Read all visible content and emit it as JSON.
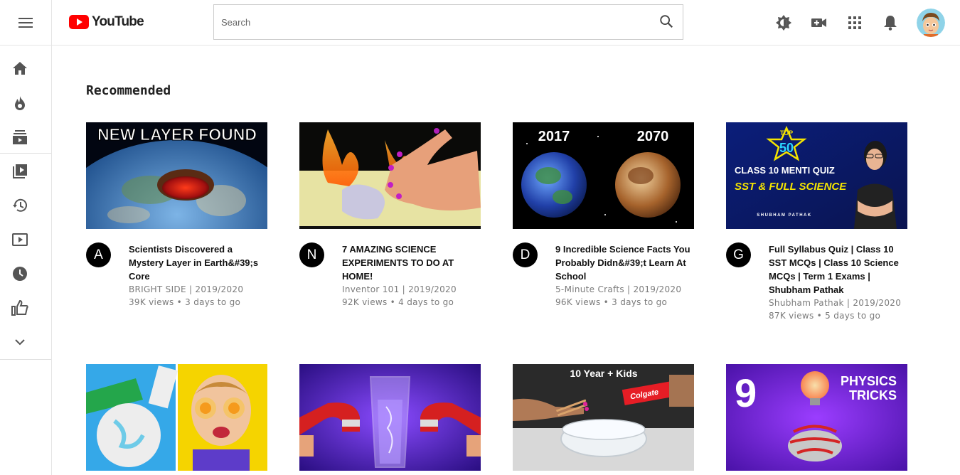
{
  "app": {
    "logo_text": "YouTube"
  },
  "search": {
    "placeholder": "Search",
    "value": ""
  },
  "header_icons": [
    "theme-icon",
    "upload-icon",
    "apps-icon",
    "notifications-icon"
  ],
  "sidebar": {
    "items": [
      "home-icon",
      "trending-icon",
      "subscriptions-icon",
      "library-icon",
      "history-icon",
      "your-videos-icon",
      "watch-later-icon",
      "liked-videos-icon",
      "show-more-icon"
    ]
  },
  "section": {
    "title": "Recommended"
  },
  "videos": [
    {
      "title": "Scientists Discovered a Mystery Layer in Earth&#39;s Core",
      "channel_initial": "A",
      "byline": "BRIGHT SIDE | 2019/2020",
      "stats": "39K views • 3 days to go",
      "thumb_text": "NEW LAYER FOUND"
    },
    {
      "title": "7 AMAZING SCIENCE EXPERIMENTS TO DO AT HOME!",
      "channel_initial": "N",
      "byline": "Inventor 101 | 2019/2020",
      "stats": "92K views • 4 days to go"
    },
    {
      "title": "9 Incredible Science Facts You Probably Didn&#39;t Learn At School",
      "channel_initial": "D",
      "byline": "5-Minute Crafts | 2019/2020",
      "stats": "96K views • 3 days to go",
      "thumb_left": "2017",
      "thumb_right": "2070"
    },
    {
      "title": "Full Syllabus Quiz | Class 10 SST MCQs | Class 10 Science MCQs | Term 1 Exams | Shubham Pathak",
      "channel_initial": "G",
      "byline": "Shubham Pathak | 2019/2020",
      "stats": "87K views • 5 days to go",
      "thumb_badge_top": "TOP",
      "thumb_badge_num": "50",
      "thumb_line1": "CLASS 10 MENTI QUIZ",
      "thumb_line2": "SST & FULL SCIENCE",
      "thumb_name": "SHUBHAM PATHAK"
    },
    {
      "title": "",
      "channel_initial": "",
      "byline": "",
      "stats": ""
    },
    {
      "title": "",
      "channel_initial": "",
      "byline": "",
      "stats": ""
    },
    {
      "title": "",
      "channel_initial": "",
      "byline": "",
      "stats": "",
      "thumb_text": "10 Year + Kids",
      "thumb_brand": "Colgate"
    },
    {
      "title": "",
      "channel_initial": "",
      "byline": "",
      "stats": "",
      "thumb_num": "9",
      "thumb_text1": "PHYSICS",
      "thumb_text2": "TRICKS"
    }
  ]
}
